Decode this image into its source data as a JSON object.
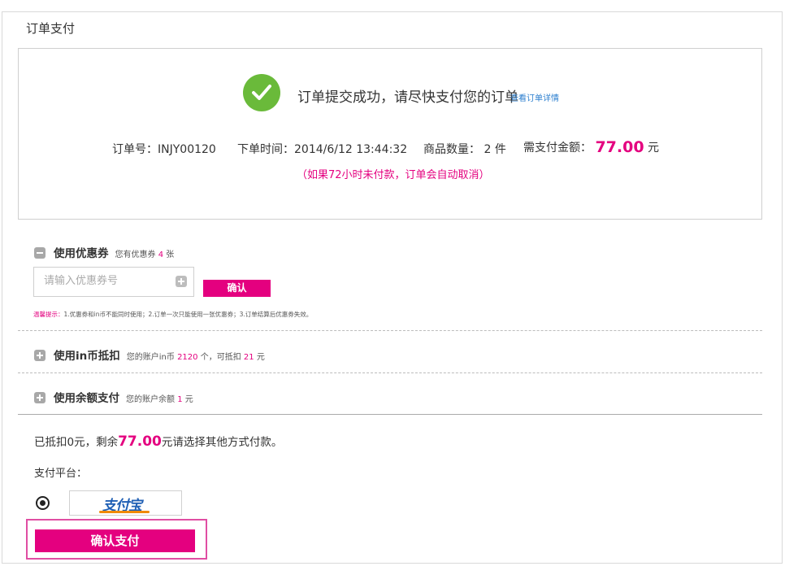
{
  "page_title": "订单支付",
  "success": {
    "message": "订单提交成功，请尽快支付您的订单",
    "detail_link": "查看订单详情"
  },
  "order": {
    "number_label": "订单号：",
    "number": "INJY00120",
    "time_label": "下单时间：",
    "time": "2014/6/12 13:44:32",
    "qty_label": "商品数量：",
    "qty": "2",
    "qty_unit": "件",
    "amount_label": "需支付金额：",
    "amount": "77.00",
    "amount_unit": "元",
    "note": "（如果72小时未付款，订单会自动取消）"
  },
  "coupon": {
    "title": "使用优惠券",
    "desc_prefix": "您有优惠券",
    "count": "4",
    "desc_suffix": "张",
    "placeholder": "请输入优惠券号",
    "confirm_label": "确认",
    "tip_label": "温馨提示：",
    "tip_text": "1.优惠券和in币不能同时使用；2.订单一次只能使用一张优惠券；3.订单结算后优惠券失效。"
  },
  "coin": {
    "title": "使用in币抵扣",
    "desc_prefix": "您的账户in币",
    "count": "2120",
    "desc_mid": "个，可抵扣",
    "deduct": "21",
    "desc_suffix": "元"
  },
  "balance": {
    "title": "使用余额支付",
    "desc_prefix": "您的账户余额",
    "value": "1",
    "desc_suffix": "元"
  },
  "summary": {
    "prefix": "已抵扣0元，剩余",
    "remaining": "77.00",
    "suffix": "元请选择其他方式付款。"
  },
  "platform": {
    "label": "支付平台：",
    "alipay_logo": "支付宝"
  },
  "pay_button": "确认支付",
  "colors": {
    "accent": "#e4007f",
    "success_green": "#6aba3a",
    "link_blue": "#2a7ecf"
  }
}
